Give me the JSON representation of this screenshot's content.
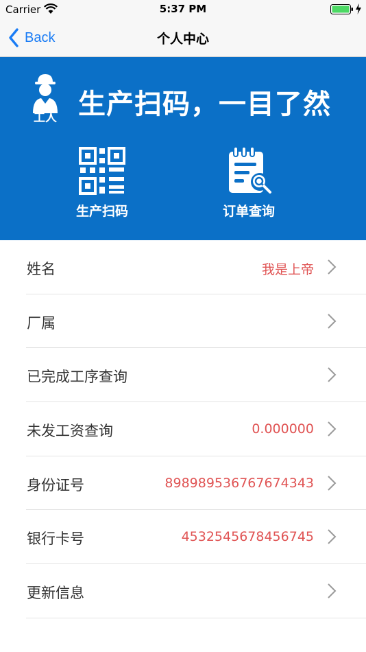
{
  "status_bar": {
    "carrier": "Carrier",
    "time": "5:37 PM",
    "wifi_icon": "wifi-icon",
    "battery_icon": "battery-icon",
    "charging_icon": "charging-bolt-icon"
  },
  "nav": {
    "back_label": "Back",
    "title": "个人中心"
  },
  "banner": {
    "worker_label": "工人",
    "slogan": "生产扫码，一目了然",
    "actions": [
      {
        "label": "生产扫码",
        "icon": "qr-code-icon"
      },
      {
        "label": "订单查询",
        "icon": "order-search-icon"
      }
    ]
  },
  "list": [
    {
      "label": "姓名",
      "value": "我是上帝"
    },
    {
      "label": "厂属",
      "value": ""
    },
    {
      "label": "已完成工序查询",
      "value": ""
    },
    {
      "label": "未发工资查询",
      "value": "0.000000"
    },
    {
      "label": "身份证号",
      "value": "898989536767674343"
    },
    {
      "label": "银行卡号",
      "value": "4532545678456745"
    },
    {
      "label": "更新信息",
      "value": ""
    }
  ],
  "colors": {
    "banner_bg": "#0b70c7",
    "value_text": "#e05454",
    "link_blue": "#1a7cf5",
    "bar_bg": "#f7f7f7"
  }
}
